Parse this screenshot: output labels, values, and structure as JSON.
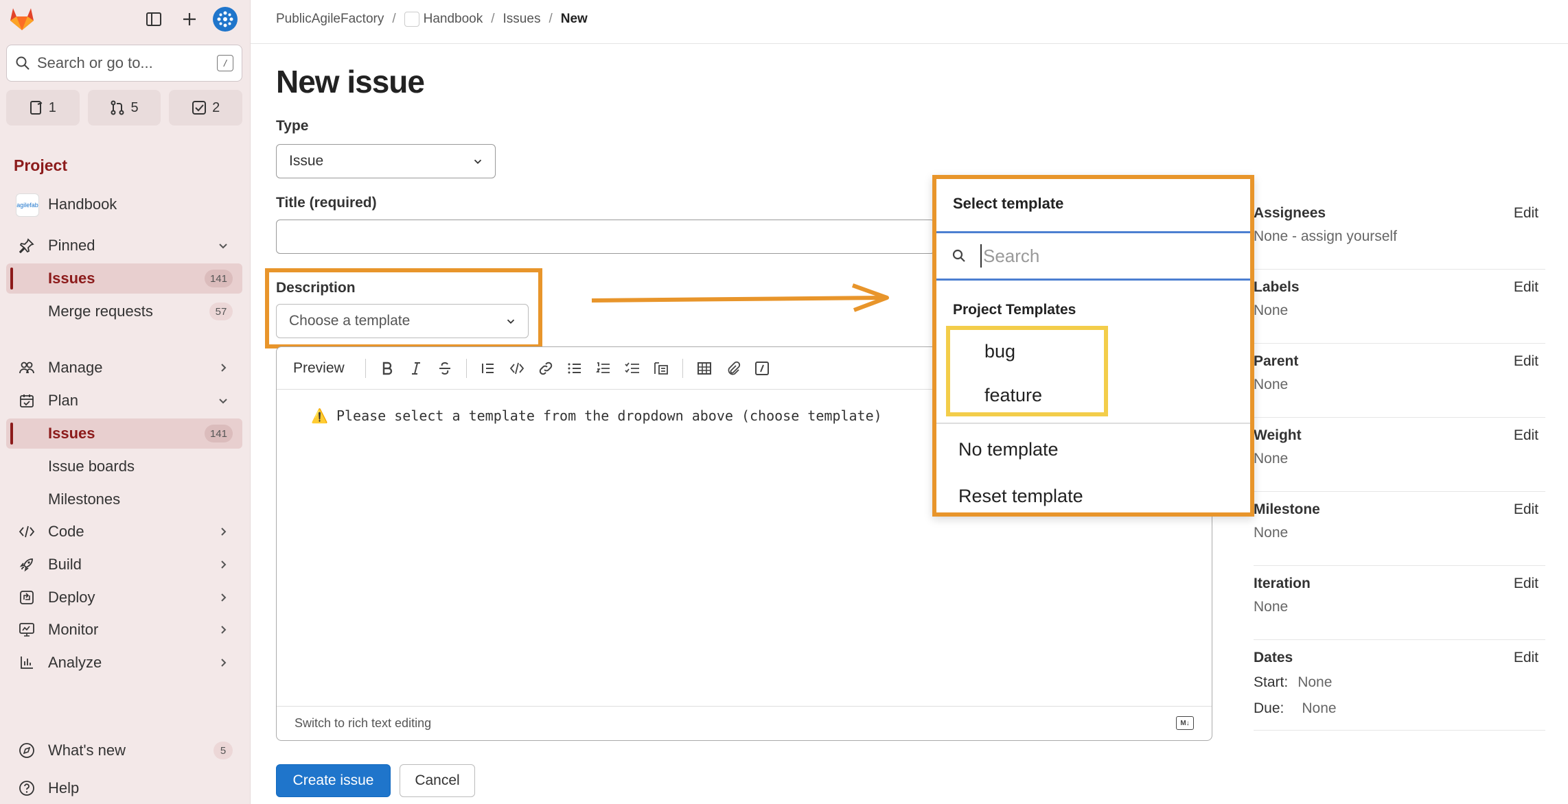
{
  "sidebar": {
    "search_placeholder": "Search or go to...",
    "search_shortcut": "/",
    "counters": [
      {
        "icon": "issues-icon",
        "count": "1"
      },
      {
        "icon": "merge-request-icon",
        "count": "5"
      },
      {
        "icon": "todo-icon",
        "count": "2"
      }
    ],
    "section_title": "Project",
    "project_name": "Handbook",
    "project_avatar_text": "agilefab",
    "pinned_label": "Pinned",
    "pinned_items": [
      {
        "label": "Issues",
        "badge": "141"
      },
      {
        "label": "Merge requests",
        "badge": "57"
      }
    ],
    "nav": {
      "manage": "Manage",
      "plan": "Plan",
      "plan_issues": "Issues",
      "plan_issues_badge": "141",
      "issue_boards": "Issue boards",
      "milestones": "Milestones",
      "code": "Code",
      "build": "Build",
      "deploy": "Deploy",
      "monitor": "Monitor",
      "analyze": "Analyze"
    },
    "whats_new": "What's new",
    "whats_new_badge": "5",
    "help": "Help"
  },
  "breadcrumb": {
    "group": "PublicAgileFactory",
    "project": "Handbook",
    "section": "Issues",
    "current": "New"
  },
  "page_title": "New issue",
  "form": {
    "type_label": "Type",
    "type_value": "Issue",
    "title_label": "Title (required)",
    "title_value": "",
    "description_label": "Description",
    "template_select": "Choose a template",
    "preview_label": "Preview",
    "editor_text": "⚠️ Please select a template from the dropdown above (choose template)",
    "switch_rich_text": "Switch to rich text editing",
    "markdown_badge": "M↓",
    "create_button": "Create issue",
    "cancel_button": "Cancel"
  },
  "template_dropdown": {
    "title": "Select template",
    "search_placeholder": "Search",
    "group_label": "Project Templates",
    "templates": [
      "bug",
      "feature"
    ],
    "no_template": "No template",
    "reset_template": "Reset template",
    "highlight_color": "#e8952b",
    "template_highlight_color": "#f3cd4a"
  },
  "right_sidebar": {
    "edit_label": "Edit",
    "assignees": {
      "title": "Assignees",
      "value": "None - assign yourself"
    },
    "labels": {
      "title": "Labels",
      "value": "None"
    },
    "parent": {
      "title": "Parent",
      "value": "None"
    },
    "weight": {
      "title": "Weight",
      "value": "None"
    },
    "milestone": {
      "title": "Milestone",
      "value": "None"
    },
    "iteration": {
      "title": "Iteration",
      "value": "None"
    },
    "dates": {
      "title": "Dates",
      "start_label": "Start:",
      "start_value": "None",
      "due_label": "Due:",
      "due_value": "None"
    }
  },
  "colors": {
    "sidebar_bg": "#f3e8e8",
    "accent": "#8c1b1b",
    "primary": "#1f75cb",
    "annotation": "#e8952b"
  }
}
